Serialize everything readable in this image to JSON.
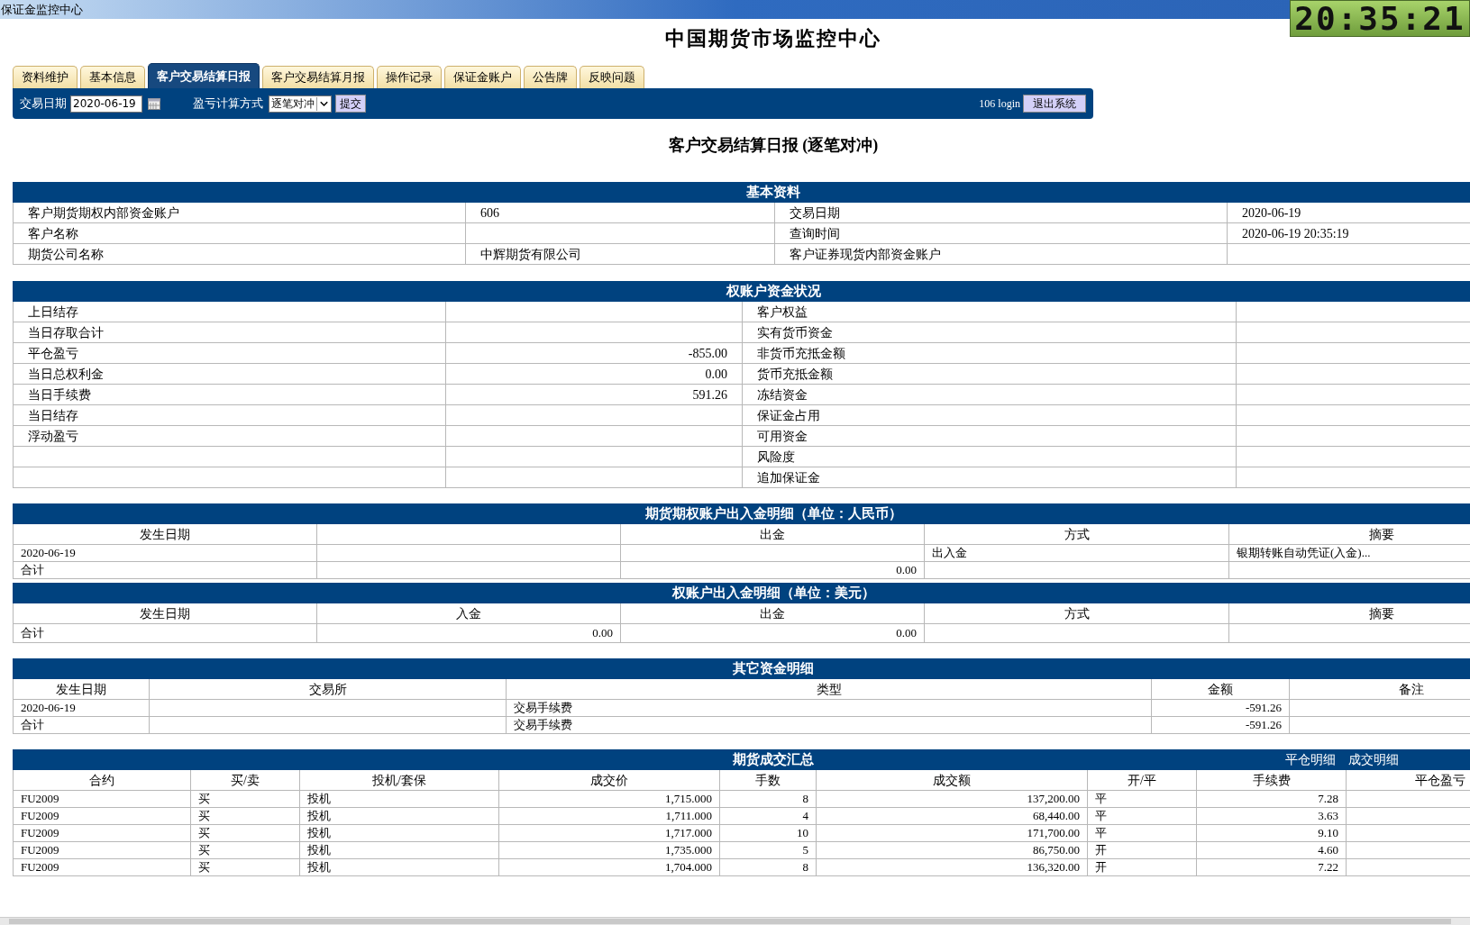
{
  "window": {
    "title": "保证金监控中心"
  },
  "clock": "20:35:21",
  "page_title": "中国期货市场监控中心",
  "tabs": [
    {
      "label": "资料维护",
      "selected": false
    },
    {
      "label": "基本信息",
      "selected": false
    },
    {
      "label": "客户交易结算日报",
      "selected": true
    },
    {
      "label": "客户交易结算月报",
      "selected": false
    },
    {
      "label": "操作记录",
      "selected": false
    },
    {
      "label": "保证金账户",
      "selected": false
    },
    {
      "label": "公告牌",
      "selected": false
    },
    {
      "label": "反映问题",
      "selected": false
    }
  ],
  "toolbar": {
    "date_label": "交易日期",
    "date_value": "2020-06-19",
    "method_label": "盈亏计算方式",
    "method_value": "逐笔对冲",
    "submit": "提交",
    "user": "106 login",
    "logout": "退出系统"
  },
  "report_title": "客户交易结算日报 (逐笔对冲)",
  "basic_info": {
    "title": "基本资料",
    "rows": [
      [
        {
          "text": "客户期货期权内部资金账户"
        },
        {
          "text": "606"
        },
        {
          "text": "交易日期"
        },
        {
          "text": "2020-06-19"
        }
      ],
      [
        {
          "text": "客户名称"
        },
        {},
        {
          "text": "查询时间"
        },
        {
          "text": "2020-06-19 20:35:19"
        }
      ],
      [
        {
          "text": "期货公司名称"
        },
        {
          "text": "中辉期货有限公司"
        },
        {
          "text": "客户证券现货内部资金账户"
        },
        {}
      ]
    ]
  },
  "funds_status": {
    "title": "权账户资金状况",
    "rows": [
      [
        {
          "text": "上日结存"
        },
        {},
        {
          "text": "客户权益"
        },
        {}
      ],
      [
        {
          "text": "当日存取合计"
        },
        {},
        {
          "text": "实有货币资金"
        },
        {}
      ],
      [
        {
          "text": "平仓盈亏"
        },
        {
          "text": "-855.00"
        },
        {
          "text": "非货币充抵金额"
        },
        {}
      ],
      [
        {
          "text": "当日总权利金"
        },
        {
          "text": "0.00"
        },
        {
          "text": "货币充抵金额"
        },
        {}
      ],
      [
        {
          "text": "当日手续费"
        },
        {
          "text": "591.26"
        },
        {
          "text": "冻结资金"
        },
        {}
      ],
      [
        {
          "text": "当日结存"
        },
        {},
        {
          "text": "保证金占用"
        },
        {}
      ],
      [
        {
          "text": "浮动盈亏"
        },
        {},
        {
          "text": "可用资金"
        },
        {}
      ],
      [
        {},
        {},
        {
          "text": "风险度"
        },
        {}
      ],
      [
        {},
        {},
        {
          "text": "追加保证金"
        },
        {}
      ]
    ]
  },
  "cny_flow": {
    "title": "期货期权账户出入金明细（单位：人民币）",
    "columns": [
      {
        "label": "发生日期"
      },
      {},
      {
        "label": "出金"
      },
      {
        "label": "方式"
      },
      {
        "label": "摘要"
      }
    ],
    "rows": [
      [
        {
          "text": "2020-06-19"
        },
        {},
        {},
        {
          "text": "出入金"
        },
        {
          "text": "银期转账自动凭证(入金)..."
        }
      ],
      [
        {
          "text": "合计"
        },
        {},
        {
          "text": "0.00"
        },
        {},
        {}
      ]
    ]
  },
  "usd_flow": {
    "title": "权账户出入金明细（单位：美元）",
    "columns": [
      {
        "label": "发生日期"
      },
      {
        "label": "入金"
      },
      {
        "label": "出金"
      },
      {
        "label": "方式"
      },
      {
        "label": "摘要"
      }
    ],
    "rows": [
      [
        {
          "text": "合计"
        },
        {
          "text": "0.00"
        },
        {
          "text": "0.00"
        },
        {},
        {}
      ]
    ]
  },
  "other_funds": {
    "title": "其它资金明细",
    "columns": [
      {
        "label": "发生日期"
      },
      {
        "label": "交易所"
      },
      {
        "label": "类型"
      },
      {
        "label": "金额"
      },
      {
        "label": "备注"
      }
    ],
    "rows": [
      [
        {
          "text": "2020-06-19"
        },
        {},
        {
          "text": "交易手续费"
        },
        {
          "text": "-591.26"
        },
        {}
      ],
      [
        {
          "text": "合计"
        },
        {},
        {
          "text": "交易手续费"
        },
        {
          "text": "-591.26"
        },
        {}
      ]
    ]
  },
  "trade_summary": {
    "title": "期货成交汇总",
    "links": [
      "平仓明细",
      "成交明细"
    ],
    "columns": [
      {
        "label": "合约"
      },
      {
        "label": "买/卖"
      },
      {
        "label": "投机/套保"
      },
      {
        "label": "成交价"
      },
      {
        "label": "手数"
      },
      {
        "label": "成交额"
      },
      {
        "label": "开/平"
      },
      {
        "label": "手续费"
      },
      {
        "label": "平仓盈亏"
      }
    ],
    "rows": [
      [
        {
          "text": "FU2009"
        },
        {
          "text": "买"
        },
        {
          "text": "投机"
        },
        {
          "text": "1,715.000"
        },
        {
          "text": "8"
        },
        {
          "text": "137,200.00"
        },
        {
          "text": "平"
        },
        {
          "text": "7.28"
        },
        {}
      ],
      [
        {
          "text": "FU2009"
        },
        {
          "text": "买"
        },
        {
          "text": "投机"
        },
        {
          "text": "1,711.000"
        },
        {
          "text": "4"
        },
        {
          "text": "68,440.00"
        },
        {
          "text": "平"
        },
        {
          "text": "3.63"
        },
        {}
      ],
      [
        {
          "text": "FU2009"
        },
        {
          "text": "买"
        },
        {
          "text": "投机"
        },
        {
          "text": "1,717.000"
        },
        {
          "text": "10"
        },
        {
          "text": "171,700.00"
        },
        {
          "text": "平"
        },
        {
          "text": "9.10"
        },
        {}
      ],
      [
        {
          "text": "FU2009"
        },
        {
          "text": "买"
        },
        {
          "text": "投机"
        },
        {
          "text": "1,735.000"
        },
        {
          "text": "5"
        },
        {
          "text": "86,750.00"
        },
        {
          "text": "开"
        },
        {
          "text": "4.60"
        },
        {}
      ],
      [
        {
          "text": "FU2009"
        },
        {
          "text": "买"
        },
        {
          "text": "投机"
        },
        {
          "text": "1,704.000"
        },
        {
          "text": "8"
        },
        {
          "text": "136,320.00"
        },
        {
          "text": "开"
        },
        {
          "text": "7.22"
        },
        {}
      ]
    ]
  }
}
